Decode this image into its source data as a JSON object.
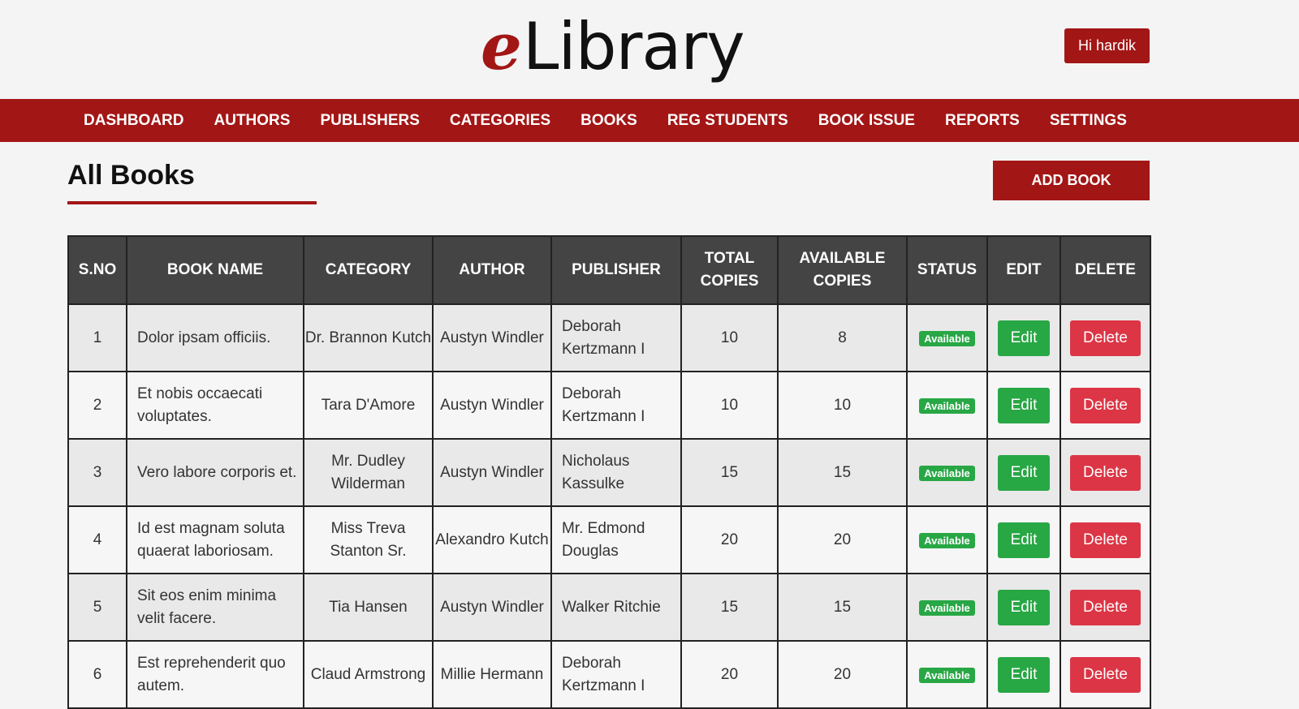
{
  "header": {
    "logo_e": "e",
    "logo_rest": "Library",
    "user_greeting": "Hi hardik"
  },
  "nav": {
    "items": [
      "DASHBOARD",
      "AUTHORS",
      "PUBLISHERS",
      "CATEGORIES",
      "BOOKS",
      "REG STUDENTS",
      "BOOK ISSUE",
      "REPORTS",
      "SETTINGS"
    ]
  },
  "page": {
    "title": "All Books",
    "add_button": "ADD BOOK"
  },
  "table": {
    "columns": [
      "S.NO",
      "BOOK NAME",
      "CATEGORY",
      "AUTHOR",
      "PUBLISHER",
      "TOTAL COPIES",
      "AVAILABLE COPIES",
      "STATUS",
      "EDIT",
      "DELETE"
    ],
    "rows": [
      {
        "sno": "1",
        "name": "Dolor ipsam officiis.",
        "category": "Dr. Brannon Kutch",
        "author": "Austyn Windler",
        "publisher": "Deborah Kertzmann I",
        "total": "10",
        "available": "8",
        "status": "Available",
        "edit": "Edit",
        "delete": "Delete"
      },
      {
        "sno": "2",
        "name": "Et nobis occaecati voluptates.",
        "category": "Tara D'Amore",
        "author": "Austyn Windler",
        "publisher": "Deborah Kertzmann I",
        "total": "10",
        "available": "10",
        "status": "Available",
        "edit": "Edit",
        "delete": "Delete"
      },
      {
        "sno": "3",
        "name": "Vero labore corporis et.",
        "category": "Mr. Dudley Wilderman",
        "author": "Austyn Windler",
        "publisher": "Nicholaus Kassulke",
        "total": "15",
        "available": "15",
        "status": "Available",
        "edit": "Edit",
        "delete": "Delete"
      },
      {
        "sno": "4",
        "name": "Id est magnam soluta quaerat laboriosam.",
        "category": "Miss Treva Stanton Sr.",
        "author": "Alexandro Kutch",
        "publisher": "Mr. Edmond Douglas",
        "total": "20",
        "available": "20",
        "status": "Available",
        "edit": "Edit",
        "delete": "Delete"
      },
      {
        "sno": "5",
        "name": "Sit eos enim minima velit facere.",
        "category": "Tia Hansen",
        "author": "Austyn Windler",
        "publisher": "Walker Ritchie",
        "total": "15",
        "available": "15",
        "status": "Available",
        "edit": "Edit",
        "delete": "Delete"
      },
      {
        "sno": "6",
        "name": "Est reprehenderit quo autem.",
        "category": "Claud Armstrong",
        "author": "Millie Hermann",
        "publisher": "Deborah Kertzmann I",
        "total": "20",
        "available": "20",
        "status": "Available",
        "edit": "Edit",
        "delete": "Delete"
      }
    ]
  },
  "colors": {
    "brand": "#a31616",
    "header_bg": "#444444",
    "success": "#28a745",
    "danger": "#dc3545"
  }
}
